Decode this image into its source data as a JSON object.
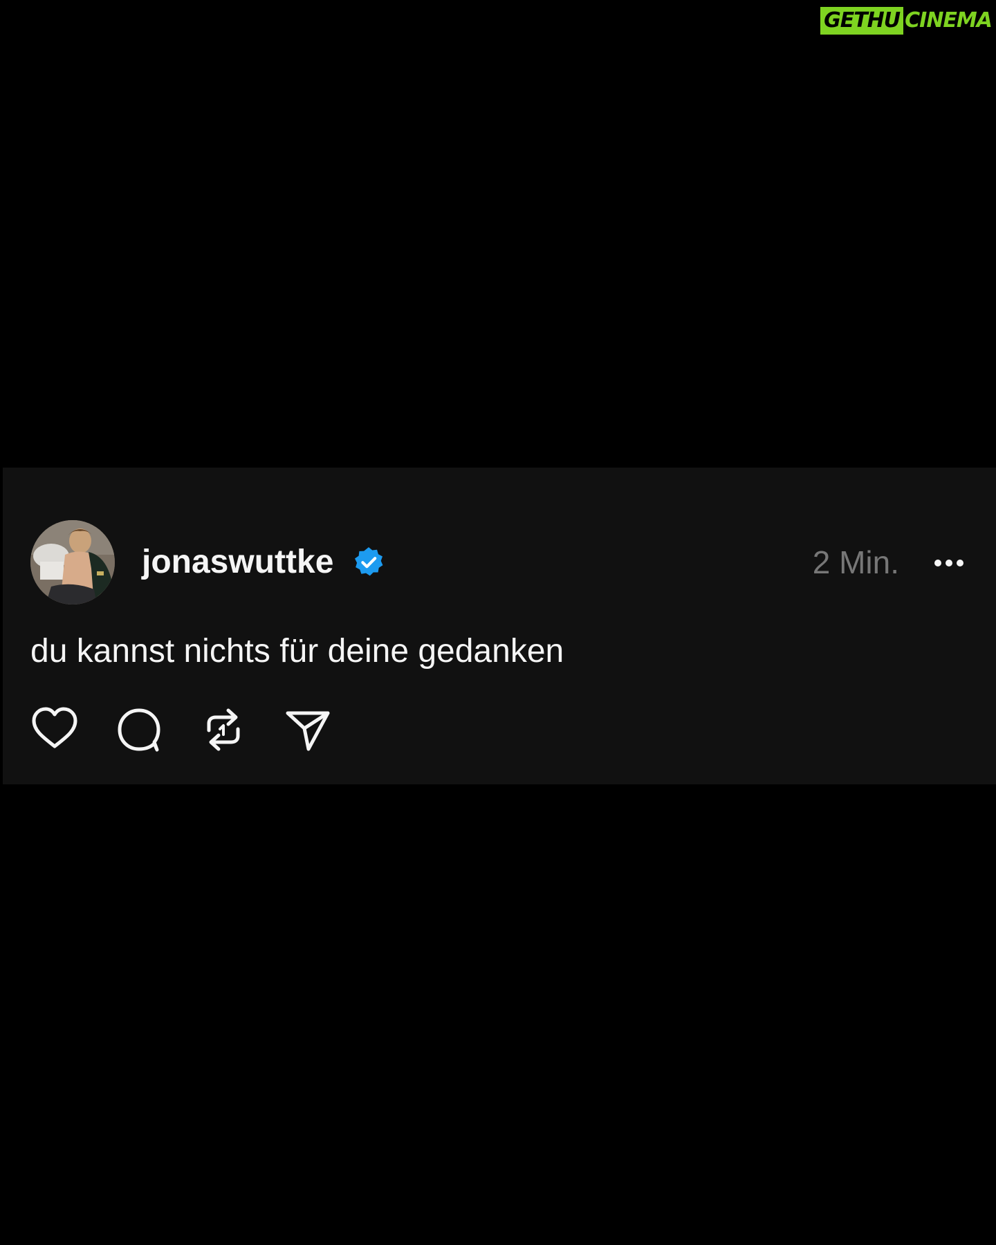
{
  "watermark": {
    "left_text": "GETHU",
    "right_text": "CINEMA",
    "color": "#7ed321"
  },
  "post": {
    "avatar_icon": "user-photo",
    "username": "jonaswuttke",
    "verified_icon": "verified-badge-icon",
    "verified_color": "#1d9bf0",
    "timestamp": "2 Min.",
    "more_icon": "more-horizontal-icon",
    "text": "du kannst nichts für deine gedanken",
    "actions": [
      {
        "name": "like",
        "icon": "heart-icon"
      },
      {
        "name": "reply",
        "icon": "comment-icon"
      },
      {
        "name": "repost",
        "icon": "repost-icon"
      },
      {
        "name": "share",
        "icon": "send-icon"
      }
    ]
  },
  "colors": {
    "background": "#000000",
    "card": "#111111",
    "text": "#f5f5f5",
    "muted": "#777777"
  }
}
